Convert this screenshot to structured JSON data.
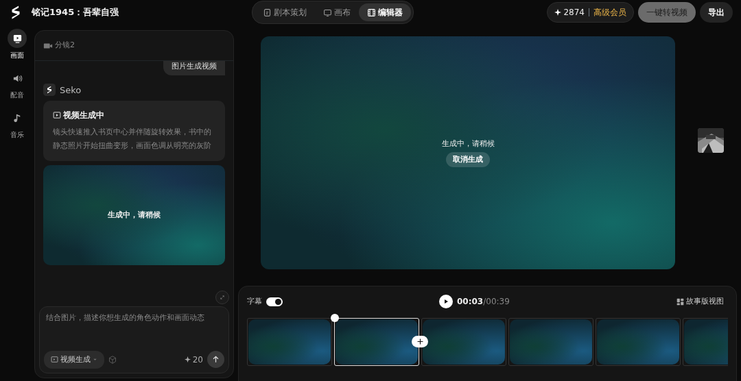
{
  "project_title": "铭记1945：吾辈自强",
  "mode_tabs": [
    {
      "label": "剧本策划",
      "selected": false
    },
    {
      "label": "画布",
      "selected": false
    },
    {
      "label": "编辑器",
      "selected": true
    }
  ],
  "credits": "2874",
  "membership": "高级会员",
  "convert_button": "一键转视频",
  "export_button": "导出",
  "rail": [
    {
      "label": "画面",
      "selected": true
    },
    {
      "label": "配音",
      "selected": false
    },
    {
      "label": "音乐",
      "selected": false
    }
  ],
  "panel": {
    "shot_label": "分镜2",
    "user_message": "图片生成视频",
    "assistant_name": "Seko",
    "task_title": "视频生成中",
    "task_description": "镜头快速推入书页中心并伴随旋转效果，书中的静态照片开始扭曲变形，画面色调从明亮的灰阶",
    "preview_status": "生成中，请稍候",
    "prompt_placeholder": "结合图片，描述你想生成的角色动作和画面动态",
    "mode_button": "视频生成",
    "cost": "20"
  },
  "preview": {
    "status": "生成中，请稍候",
    "cancel_button": "取消生成"
  },
  "timeline": {
    "subtitle_label": "字幕",
    "subtitles_on": true,
    "current_time": "00:03",
    "time_separator": "/",
    "total_time": "00:39",
    "storyboard_button": "故事版视图",
    "clips": [
      {
        "selected": false
      },
      {
        "selected": true
      },
      {
        "selected": false
      },
      {
        "selected": false
      },
      {
        "selected": false
      },
      {
        "selected": false
      }
    ]
  }
}
